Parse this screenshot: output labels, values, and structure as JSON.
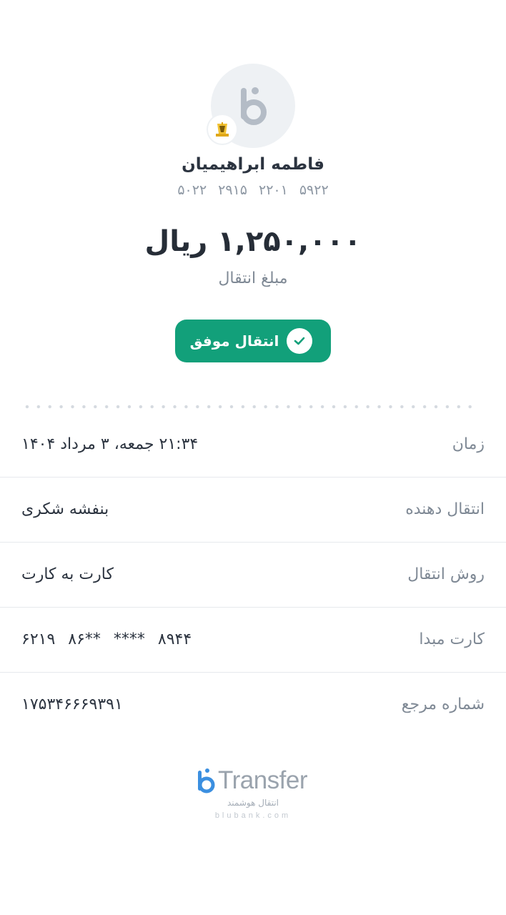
{
  "receiver": {
    "name": "فاطمه ابراهیمیان",
    "card_groups": [
      "۵۰۲۲",
      "۲۹۱۵",
      "۲۲۰۱",
      "۵۹۲۲"
    ]
  },
  "transfer": {
    "amount": "۱,۲۵۰,۰۰۰ ریال",
    "amount_label": "مبلغ انتقال",
    "status": "انتقال موفق"
  },
  "details": {
    "time": {
      "label": "زمان",
      "value": "۲۱:۳۴ جمعه، ۳ مرداد ۱۴۰۴"
    },
    "sender": {
      "label": "انتقال دهنده",
      "value": "بنفشه شکری"
    },
    "method": {
      "label": "روش انتقال",
      "value": "کارت به کارت"
    },
    "source_card": {
      "label": "کارت مبدا",
      "groups": [
        "۶۲۱۹",
        "۸۶**",
        "****",
        "۸۹۴۴"
      ]
    },
    "reference": {
      "label": "شماره مرجع",
      "value": "۱۷۵۳۴۶۶۶۹۳۹۱"
    }
  },
  "brand": {
    "name": "Transfer",
    "tagline": "انتقال هوشمند",
    "url": "blubank.com"
  },
  "colors": {
    "success": "#12a07a",
    "brand_blue": "#3b8fe0",
    "muted_text": "#7f8995"
  },
  "icons": {
    "avatar": "blubank-logo",
    "bank_badge": "bank-icon",
    "status": "check-icon"
  }
}
